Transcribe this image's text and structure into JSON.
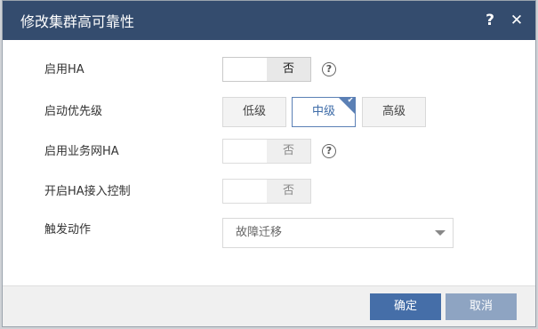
{
  "dialog": {
    "title": "修改集群高可靠性",
    "help_icon": "?",
    "close_icon": "✕"
  },
  "form": {
    "enable_ha": {
      "label": "启用HA",
      "toggle_value": "否",
      "help": "?"
    },
    "priority": {
      "label": "启动优先级",
      "options": [
        "低级",
        "中级",
        "高级"
      ],
      "selected": "中级"
    },
    "business_net_ha": {
      "label": "启用业务网HA",
      "toggle_value": "否",
      "help": "?"
    },
    "admission_control": {
      "label": "开启HA接入控制",
      "toggle_value": "否"
    },
    "trigger_action": {
      "label": "触发动作",
      "value": "故障迁移"
    }
  },
  "footer": {
    "confirm_label": "确定",
    "cancel_label": "取消"
  },
  "colors": {
    "titlebar": "#344c6e",
    "accent": "#5b80b5",
    "confirm": "#456ea8",
    "cancel": "#8ea4c2"
  }
}
